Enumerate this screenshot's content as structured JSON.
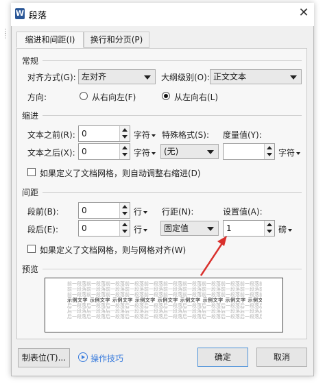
{
  "dialog": {
    "title": "段落",
    "logo_letter": "W",
    "close_glyph": "✕"
  },
  "tabs": [
    {
      "label": "缩进和间距(I)",
      "active": true
    },
    {
      "label": "换行和分页(P)",
      "active": false
    }
  ],
  "general": {
    "heading": "常规",
    "align_label": "对齐方式(G):",
    "align_value": "左对齐",
    "outline_label": "大纲级别(O):",
    "outline_value": "正文文本",
    "direction_label": "方向:",
    "rtl_label": "从右向左(F)",
    "ltr_label": "从左向右(L)",
    "direction_selected": "ltr"
  },
  "indent": {
    "heading": "缩进",
    "before_label": "文本之前(R):",
    "before_value": "0",
    "before_unit": "字符",
    "after_label": "文本之后(X):",
    "after_value": "0",
    "after_unit": "字符",
    "special_label": "特殊格式(S):",
    "special_value": "(无)",
    "measure_label": "度量值(Y):",
    "measure_value": "",
    "measure_unit": "字符",
    "grid_check_label": "如果定义了文档网格，则自动调整右缩进(D)",
    "grid_checked": false
  },
  "spacing": {
    "heading": "间距",
    "before_label": "段前(B):",
    "before_value": "0",
    "before_unit": "行",
    "after_label": "段后(E):",
    "after_value": "0",
    "after_unit": "行",
    "line_label": "行距(N):",
    "line_value": "固定值",
    "setting_label": "设置值(A):",
    "setting_value": "1",
    "setting_unit": "磅",
    "grid_check_label": "如果定义了文档网格，则与网格对齐(W)",
    "grid_checked": false
  },
  "preview": {
    "heading": "预览",
    "prev_text": "前一段落前一段落前一段落前一段落前一段落前一段落前一段落前一段落前一段落前一段落前一段落前一段落",
    "cur_text": "示例文字 示例文字 示例文字 示例文字 示例文字 示例文字 示例文字 示例文字 示例文字",
    "next_text": "后一段落后一段落后一段落后一段落后一段落后一段落后一段落后一段落后一段落后一段落后一段落后一段落"
  },
  "footer": {
    "tabs_button": "制表位(T)...",
    "tips_label": "操作技巧",
    "ok": "确定",
    "cancel": "取消"
  },
  "colors": {
    "arrow": "#d9302c",
    "accent": "#3b7ddd"
  }
}
